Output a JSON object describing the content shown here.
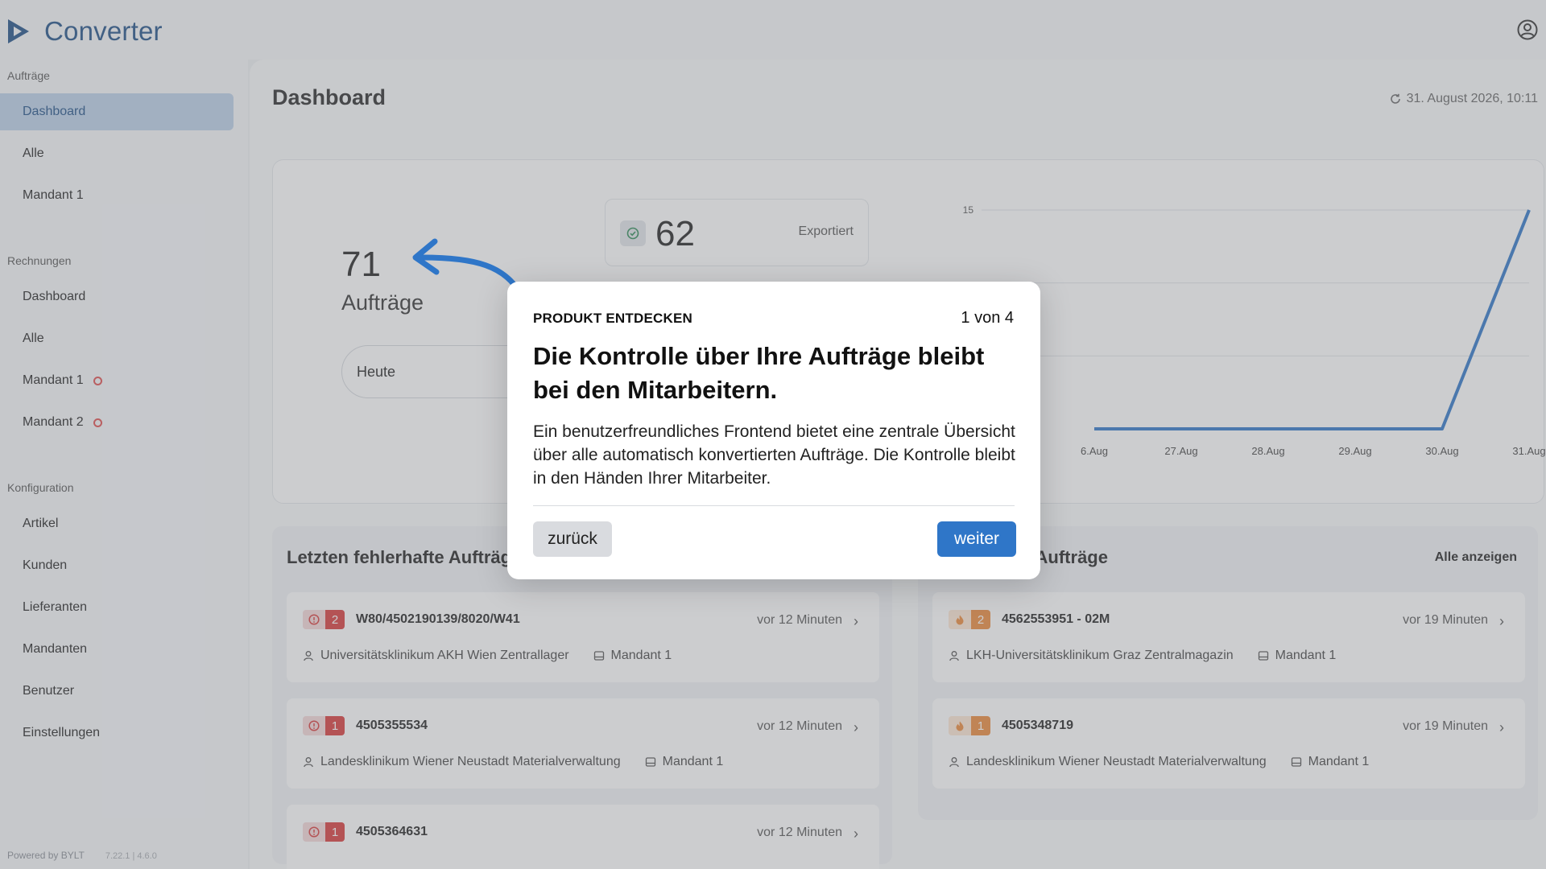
{
  "app": {
    "brand": "Converter"
  },
  "sidebar": {
    "sections": [
      {
        "title": "Aufträge",
        "items": [
          {
            "label": "Dashboard",
            "active": true
          },
          {
            "label": "Alle"
          },
          {
            "label": "Mandant 1"
          }
        ]
      },
      {
        "title": "Rechnungen",
        "items": [
          {
            "label": "Dashboard"
          },
          {
            "label": "Alle"
          },
          {
            "label": "Mandant 1",
            "alert": true
          },
          {
            "label": "Mandant 2",
            "alert": true
          }
        ]
      },
      {
        "title": "Konfiguration",
        "items": [
          {
            "label": "Artikel"
          },
          {
            "label": "Kunden"
          },
          {
            "label": "Lieferanten"
          },
          {
            "label": "Mandanten"
          },
          {
            "label": "Benutzer"
          },
          {
            "label": "Einstellungen"
          }
        ]
      }
    ],
    "footer": {
      "powered": "Powered by BYLT",
      "version": "7.22.1 | 4.6.0"
    }
  },
  "main": {
    "title": "Dashboard",
    "timestamp": "31. August 2026, 10:11",
    "kpi": {
      "total_value": "71",
      "total_label": "Aufträge",
      "period": "Heute",
      "exported_value": "62",
      "exported_label": "Exportiert"
    },
    "left_list": {
      "title": "Letzten fehlerhafte Aufträge",
      "items": [
        {
          "count": "2",
          "id": "W80/4502190139/8020/W41",
          "time": "vor 12 Minuten",
          "customer": "Universitätsklinikum AKH Wien Zentrallager",
          "tenant": "Mandant 1"
        },
        {
          "count": "1",
          "id": "4505355534",
          "time": "vor 12 Minuten",
          "customer": "Landesklinikum Wiener Neustadt Materialverwaltung",
          "tenant": "Mandant 1"
        },
        {
          "count": "1",
          "id": "4505364631",
          "time": "vor 12 Minuten",
          "customer": "",
          "tenant": ""
        }
      ]
    },
    "right_list": {
      "title": "...gebenden Aufträge",
      "show_all": "Alle anzeigen",
      "items": [
        {
          "count": "2",
          "id": "4562553951 - 02M",
          "time": "vor 19 Minuten",
          "customer": "LKH-Universitätsklinikum Graz Zentralmagazin",
          "tenant": "Mandant 1"
        },
        {
          "count": "1",
          "id": "4505348719",
          "time": "vor 19 Minuten",
          "customer": "Landesklinikum Wiener Neustadt Materialverwaltung",
          "tenant": "Mandant 1"
        }
      ]
    }
  },
  "tour": {
    "eyebrow": "PRODUKT ENTDECKEN",
    "step": "1 von 4",
    "heading": "Die Kontrolle über Ihre Aufträge bleibt bei den Mitarbeitern.",
    "body": "Ein benutzerfreundliches Frontend bietet eine zentrale Übersicht über alle automatisch konvertierten Aufträge. Die Kontrolle bleibt in den Händen Ihrer Mitarbeiter.",
    "back_label": "zurück",
    "next_label": "weiter"
  },
  "colors": {
    "accent": "#2f76c8",
    "brand": "#1f4f86",
    "error": "#d83a3a",
    "warning": "#ec8a3b"
  },
  "chart_data": {
    "type": "line",
    "categories": [
      "6.Aug",
      "27.Aug",
      "28.Aug",
      "29.Aug",
      "30.Aug",
      "31.Aug"
    ],
    "values": [
      0,
      0,
      0,
      0,
      0,
      15
    ],
    "ytick_labels": [
      "15"
    ],
    "ylim": [
      0,
      15
    ],
    "grid": true
  }
}
